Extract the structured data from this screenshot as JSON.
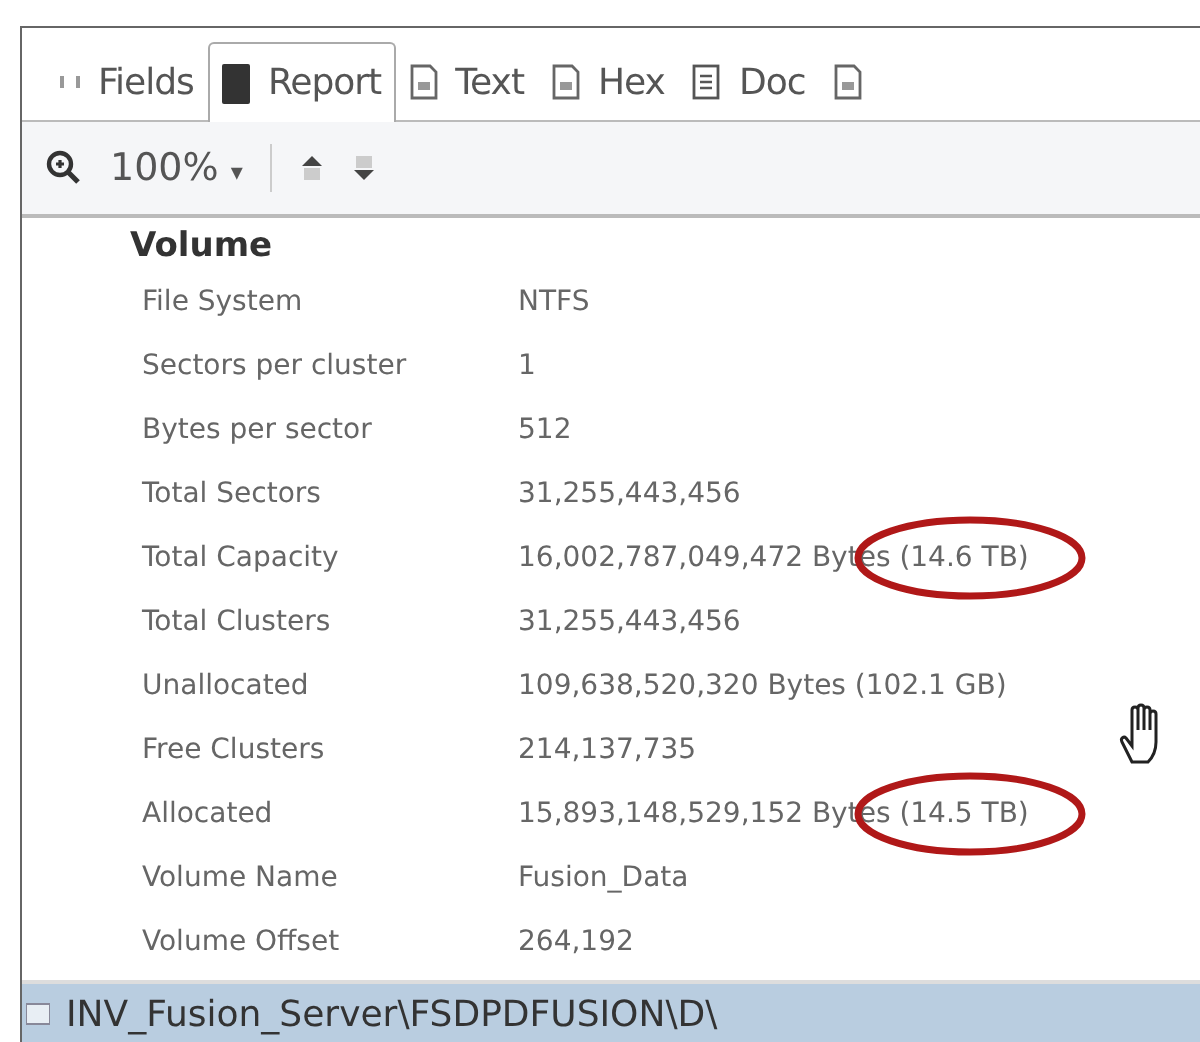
{
  "tabs": [
    {
      "label": "Fields",
      "selected": false,
      "kind": "grip"
    },
    {
      "label": "Report",
      "selected": true,
      "kind": "book"
    },
    {
      "label": "Text",
      "selected": false,
      "kind": "doc"
    },
    {
      "label": "Hex",
      "selected": false,
      "kind": "doc"
    },
    {
      "label": "Doc",
      "selected": false,
      "kind": "list"
    },
    {
      "selected": false,
      "kind": "doc"
    }
  ],
  "toolbar": {
    "zoom": "100%",
    "caret": "▾"
  },
  "section": {
    "heading": "Volume",
    "rows": [
      {
        "label": "File System",
        "value": "NTFS",
        "circled": false
      },
      {
        "label": "Sectors per cluster",
        "value": "1",
        "circled": false
      },
      {
        "label": "Bytes per sector",
        "value": "512",
        "circled": false
      },
      {
        "label": "Total Sectors",
        "value": "31,255,443,456",
        "circled": false
      },
      {
        "label": "Total Capacity",
        "value": "16,002,787,049,472 Bytes (14.6 TB)",
        "circled": true
      },
      {
        "label": "Total Clusters",
        "value": "31,255,443,456",
        "circled": false
      },
      {
        "label": "Unallocated",
        "value": "109,638,520,320 Bytes (102.1 GB)",
        "circled": false
      },
      {
        "label": "Free Clusters",
        "value": "214,137,735",
        "circled": false
      },
      {
        "label": "Allocated",
        "value": "15,893,148,529,152 Bytes (14.5 TB)",
        "circled": true
      },
      {
        "label": "Volume Name",
        "value": "Fusion_Data",
        "circled": false
      },
      {
        "label": "Volume Offset",
        "value": "264,192",
        "circled": false
      }
    ]
  },
  "status_bar": {
    "path": "INV_Fusion_Server\\FSDPDFUSION\\D\\"
  }
}
